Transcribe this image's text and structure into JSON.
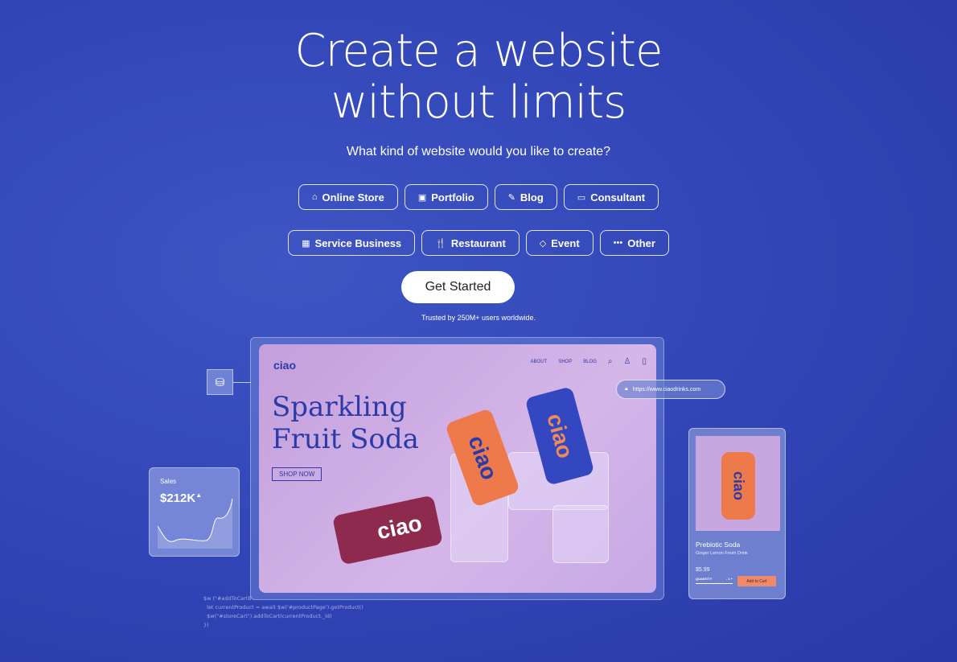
{
  "hero": {
    "title_line1": "Create a website",
    "title_line2": "without limits",
    "subtitle": "What kind of website would you like to create?"
  },
  "categories_row1": [
    {
      "icon": "store-icon",
      "glyph": "⌂",
      "label": "Online Store"
    },
    {
      "icon": "portfolio-icon",
      "glyph": "▣",
      "label": "Portfolio"
    },
    {
      "icon": "pen-icon",
      "glyph": "✎",
      "label": "Blog"
    },
    {
      "icon": "briefcase-icon",
      "glyph": "▭",
      "label": "Consultant"
    }
  ],
  "categories_row2": [
    {
      "icon": "calendar-icon",
      "glyph": "▦",
      "label": "Service Business"
    },
    {
      "icon": "cutlery-icon",
      "glyph": "🍴",
      "label": "Restaurant"
    },
    {
      "icon": "ticket-icon",
      "glyph": "◇",
      "label": "Event"
    },
    {
      "icon": "more-icon",
      "glyph": "•••",
      "label": "Other"
    }
  ],
  "cta": "Get Started",
  "trust": "Trusted by 250M+ users worldwide.",
  "preview": {
    "logo": "ciao",
    "nav": [
      "ABOUT",
      "SHOP",
      "BLOG"
    ],
    "headline1": "Sparkling",
    "headline2": "Fruit Soda",
    "shop_now": "SHOP NOW",
    "can_text": "ciao",
    "url": "https://www.ciaodrinks.com"
  },
  "sales": {
    "label": "Sales",
    "value": "$212K",
    "trend": "up"
  },
  "code": [
    "$w (\"#addToCartB",
    "  let currentProduct = await $w('#productPage').getProduct()",
    "  $w(\"#storeCart\").addToCart(currentProduct._id)",
    "})"
  ],
  "product": {
    "name": "Prebiotic Soda",
    "description": "Ginger Lemon Fresh Drink",
    "price": "$5.99",
    "quantity_label": "QUANTITY",
    "quantity": "1",
    "add_to_cart": "Add to Cart"
  },
  "colors": {
    "background": "#3347b8",
    "accent_blue": "#2b3aa8",
    "cta_bg": "#ffffff",
    "add_to_cart": "#f0886a",
    "can_orange": "#ee7a4c",
    "can_blue": "#3347c0",
    "can_red": "#8e2a4e"
  }
}
